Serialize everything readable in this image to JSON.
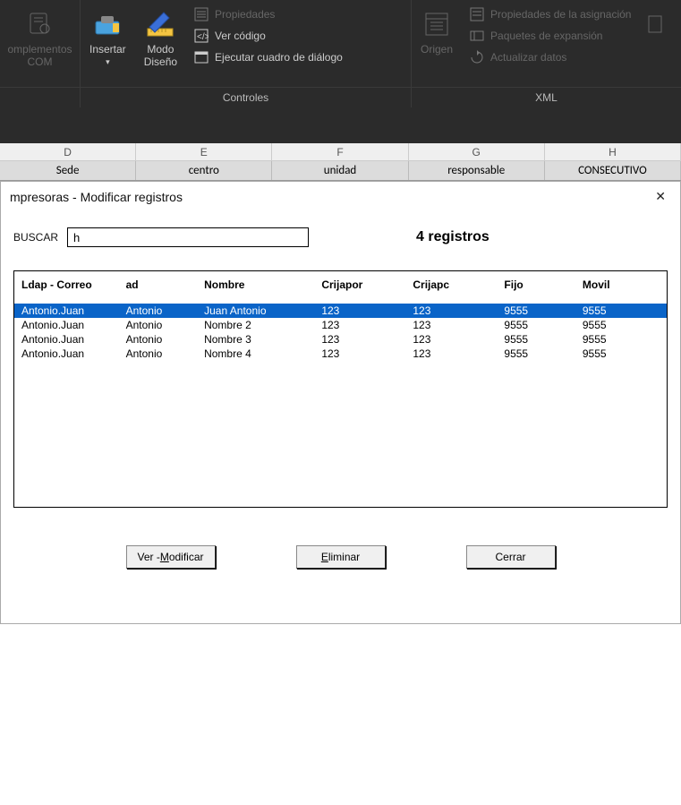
{
  "ribbon": {
    "group_complementos": {
      "label": "",
      "com_btn": "omplementos\nCOM"
    },
    "group_controles": {
      "label": "Controles",
      "insertar": "Insertar",
      "modo_diseno": "Modo\nDiseño",
      "propiedades": "Propiedades",
      "ver_codigo": "Ver código",
      "ejecutar_dialogo": "Ejecutar cuadro de diálogo"
    },
    "group_xml": {
      "label": "XML",
      "origen": "Origen",
      "prop_asignacion": "Propiedades de la asignación",
      "paquetes_expansion": "Paquetes de expansión",
      "actualizar_datos": "Actualizar datos"
    }
  },
  "sheet": {
    "letters": [
      "D",
      "E",
      "F",
      "G",
      "H"
    ],
    "headers": [
      "Sede",
      "centro",
      "unidad",
      "responsable",
      "CONSECUTIVO"
    ]
  },
  "dialog": {
    "title": "mpresoras - Modificar registros",
    "search_label": "BUSCAR",
    "search_value": "h",
    "records_text": "4 registros"
  },
  "grid": {
    "columns": [
      "Ldap - Correo",
      "ad",
      "Nombre",
      "Crijapor",
      "Crijapc",
      "Fijo",
      "Movil"
    ],
    "rows": [
      {
        "ldap": "Antonio.Juan",
        "ad": "Antonio",
        "nombre": "Juan Antonio",
        "crijapor": "123",
        "crijapc": "123",
        "fijo": "9555",
        "movil": "9555",
        "selected": true
      },
      {
        "ldap": "Antonio.Juan",
        "ad": "Antonio",
        "nombre": "Nombre 2",
        "crijapor": "123",
        "crijapc": "123",
        "fijo": "9555",
        "movil": "9555",
        "selected": false
      },
      {
        "ldap": "Antonio.Juan",
        "ad": "Antonio",
        "nombre": "Nombre 3",
        "crijapor": "123",
        "crijapc": "123",
        "fijo": "9555",
        "movil": "9555",
        "selected": false
      },
      {
        "ldap": "Antonio.Juan",
        "ad": "Antonio",
        "nombre": "Nombre 4",
        "crijapor": "123",
        "crijapc": "123",
        "fijo": "9555",
        "movil": "9555",
        "selected": false
      }
    ]
  },
  "buttons": {
    "ver_modificar_pre": "Ver - ",
    "ver_modificar_accel": "M",
    "ver_modificar_post": "odificar",
    "eliminar_accel": "E",
    "eliminar_post": "liminar",
    "cerrar": "Cerrar"
  }
}
